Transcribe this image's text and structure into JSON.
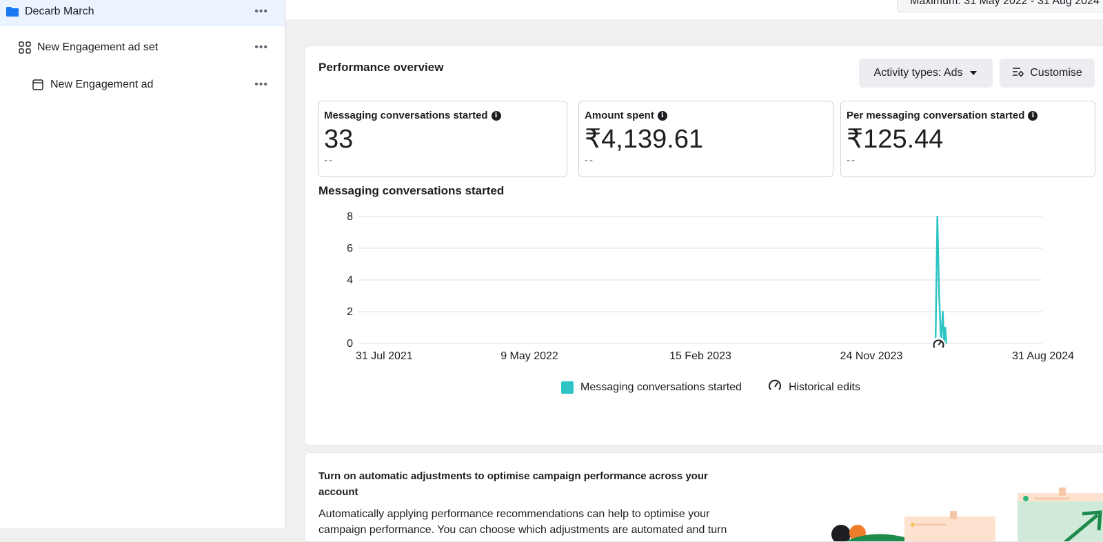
{
  "sidebar": {
    "items": [
      {
        "label": "Decarb March",
        "icon": "folder-icon",
        "more": "•••"
      },
      {
        "label": "New Engagement ad set",
        "icon": "grid-icon",
        "more": "•••"
      },
      {
        "label": "New Engagement ad",
        "icon": "ad-icon",
        "more": "•••"
      }
    ]
  },
  "header": {
    "date_range": "Maximum: 31 May 2022 - 31 Aug 2024"
  },
  "overview": {
    "title": "Performance overview",
    "activity_button": "Activity types: Ads",
    "customise_button": "Customise",
    "metrics": [
      {
        "label": "Messaging conversations started",
        "value": "33",
        "delta": "--"
      },
      {
        "label": "Amount spent",
        "value": "₹4,139.61",
        "delta": "--"
      },
      {
        "label": "Per messaging conversation started",
        "value": "₹125.44",
        "delta": "--"
      }
    ],
    "chart_title": "Messaging conversations started"
  },
  "chart_data": {
    "type": "line",
    "title": "Messaging conversations started",
    "xlabel": "",
    "ylabel": "",
    "x_tick_labels": [
      "31 Jul 2021",
      "9 May 2022",
      "15 Feb 2023",
      "24 Nov 2023",
      "31 Aug 2024"
    ],
    "x_range": [
      "2021-07-31",
      "2024-08-31"
    ],
    "y_ticks": [
      0,
      2,
      4,
      6,
      8
    ],
    "ylim": [
      0,
      8
    ],
    "grid": true,
    "legend_position": "bottom",
    "series": [
      {
        "name": "Messaging conversations started",
        "color": "#2ec4c4",
        "points": [
          {
            "x": "2024-03-08",
            "y": 0
          },
          {
            "x": "2024-03-11",
            "y": 8
          },
          {
            "x": "2024-03-14",
            "y": 3
          },
          {
            "x": "2024-03-17",
            "y": 0
          },
          {
            "x": "2024-03-20",
            "y": 2
          },
          {
            "x": "2024-03-22",
            "y": 0
          },
          {
            "x": "2024-03-24",
            "y": 1
          },
          {
            "x": "2024-03-26",
            "y": 0
          }
        ]
      }
    ],
    "annotations": [
      {
        "label": "Historical edits",
        "x": "2024-03-13",
        "icon": "gauge-icon"
      }
    ]
  },
  "legend": {
    "series_label": "Messaging conversations started",
    "edits_label": "Historical edits"
  },
  "promo": {
    "title": "Turn on automatic adjustments to optimise campaign performance across your account",
    "text": "Automatically applying performance recommendations can help to optimise your campaign performance. You can choose which adjustments are automated and turn"
  },
  "colors": {
    "accent": "#1877f2",
    "series": "#2ec4c4",
    "selected_row": "#eaf3ff"
  }
}
